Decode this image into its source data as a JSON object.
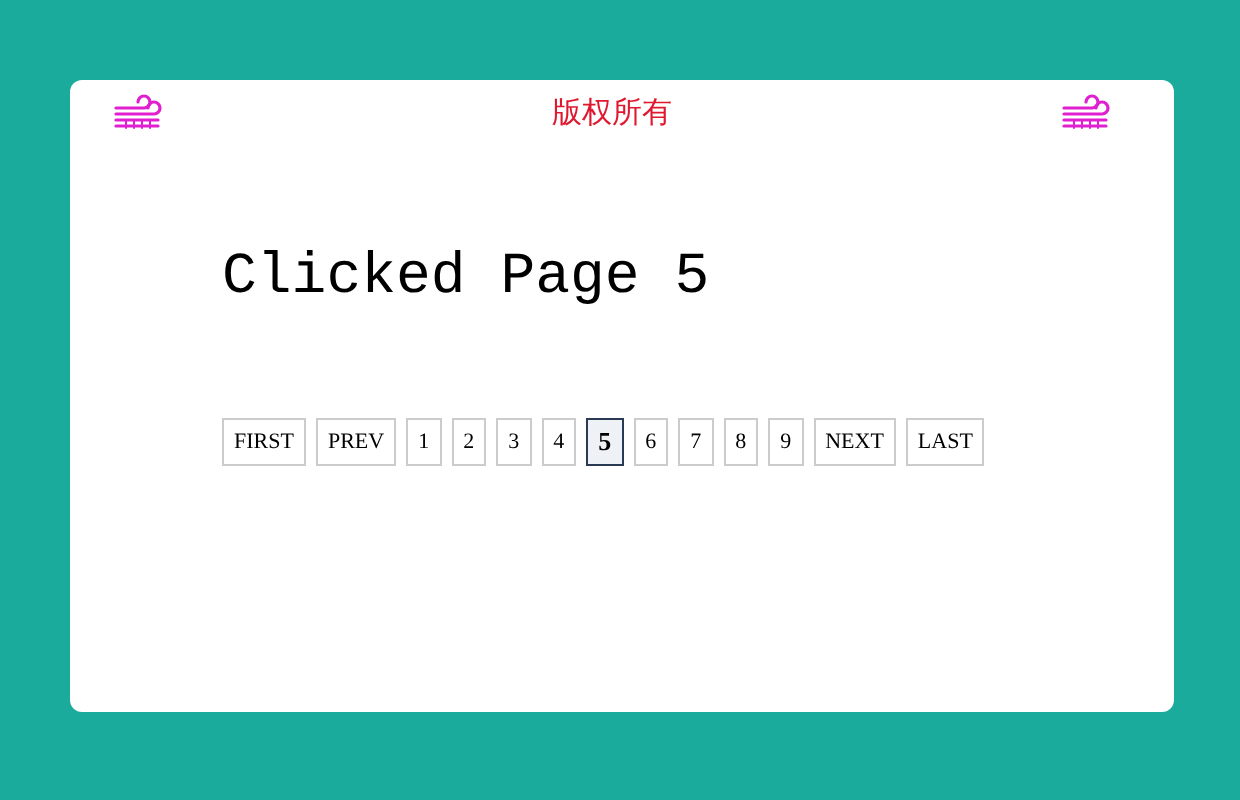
{
  "header": {
    "title": "版权所有"
  },
  "heading": "Clicked Page 5",
  "pagination": [
    {
      "label": "FIRST",
      "selected": false
    },
    {
      "label": "PREV",
      "selected": false
    },
    {
      "label": "1",
      "selected": false
    },
    {
      "label": "2",
      "selected": false
    },
    {
      "label": "3",
      "selected": false
    },
    {
      "label": "4",
      "selected": false
    },
    {
      "label": "5",
      "selected": true
    },
    {
      "label": "6",
      "selected": false
    },
    {
      "label": "7",
      "selected": false
    },
    {
      "label": "8",
      "selected": false
    },
    {
      "label": "9",
      "selected": false
    },
    {
      "label": "NEXT",
      "selected": false
    },
    {
      "label": "LAST",
      "selected": false
    }
  ]
}
